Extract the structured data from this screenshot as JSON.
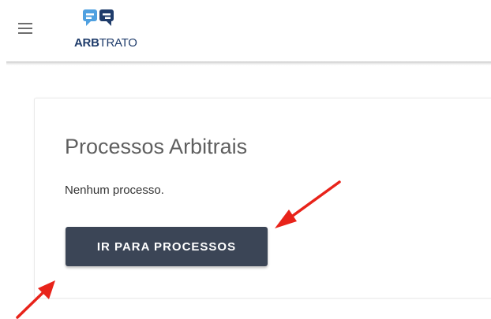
{
  "header": {
    "menu_icon": "hamburger-menu-icon",
    "logo": {
      "icon": "speech-bubbles-logo-icon",
      "text_bold": "ARB",
      "text_light": "TRATO",
      "colors": {
        "blue": "#4fa0e0",
        "dark": "#1f3c6b"
      }
    }
  },
  "card": {
    "title": "Processos Arbitrais",
    "message": "Nenhum processo.",
    "button_label": "IR PARA PROCESSOS",
    "button_color": "#3b4556"
  },
  "annotations": {
    "arrow_color": "#e8231a"
  }
}
